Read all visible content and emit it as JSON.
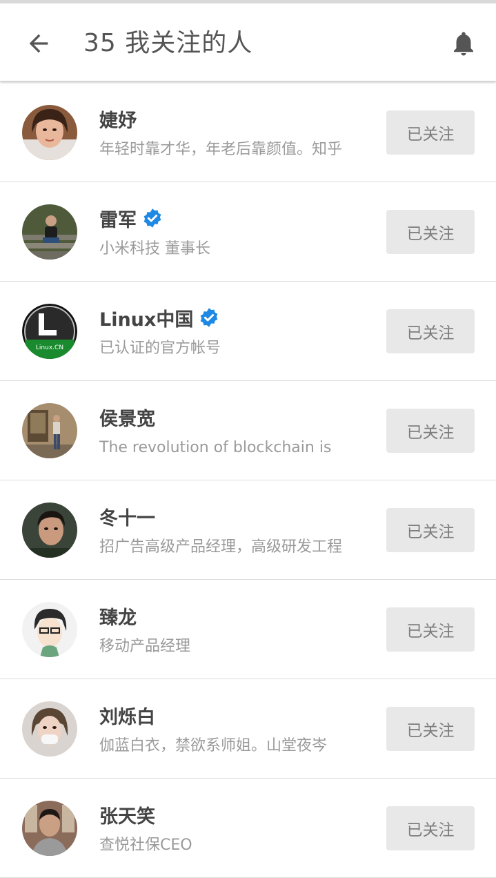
{
  "header": {
    "title": "35 我关注的人",
    "back_icon": "arrow-left-icon",
    "bell_icon": "bell-icon"
  },
  "colors": {
    "verified": "#1e88e5",
    "button_bg": "#e8e8e8",
    "text_primary": "#444444",
    "text_secondary": "#9a9a9a"
  },
  "users": [
    {
      "name": "婕妤",
      "bio": "年轻时靠才华，年老后靠颜值。知乎",
      "verified": false,
      "button": "已关注"
    },
    {
      "name": "雷军",
      "bio": "小米科技 董事长",
      "verified": true,
      "button": "已关注"
    },
    {
      "name": "Linux中国",
      "bio": "已认证的官方帐号",
      "verified": true,
      "button": "已关注",
      "avatar_text": "Linux.CN"
    },
    {
      "name": "侯景宽",
      "bio": "The revolution of blockchain is",
      "verified": false,
      "button": "已关注"
    },
    {
      "name": "冬十一",
      "bio": "招广告高级产品经理，高级研发工程",
      "verified": false,
      "button": "已关注"
    },
    {
      "name": "臻龙",
      "bio": "移动产品经理",
      "verified": false,
      "button": "已关注"
    },
    {
      "name": "刘烁白",
      "bio": "伽蓝白衣，禁欲系师姐。山堂夜岑",
      "verified": false,
      "button": "已关注"
    },
    {
      "name": "张天笑",
      "bio": "查悦社保CEO",
      "verified": false,
      "button": "已关注"
    }
  ]
}
